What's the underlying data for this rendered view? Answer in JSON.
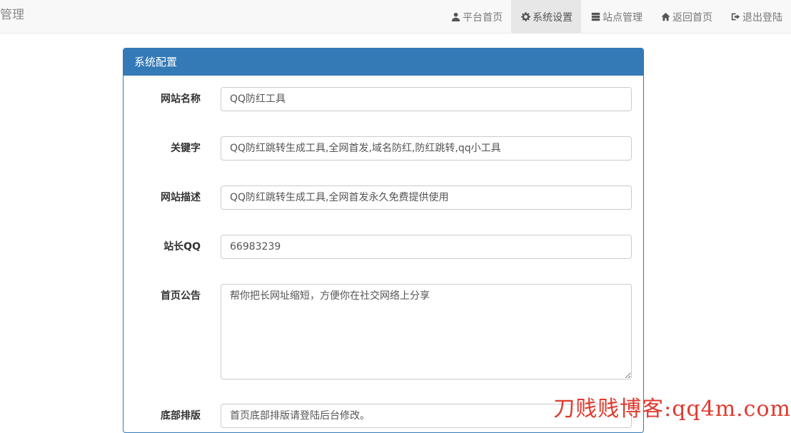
{
  "navbar": {
    "brand": "管理",
    "items": [
      {
        "label": "平台首页",
        "icon": "user-icon",
        "active": false
      },
      {
        "label": "系统设置",
        "icon": "gear-icon",
        "active": true
      },
      {
        "label": "站点管理",
        "icon": "server-icon",
        "active": false
      },
      {
        "label": "返回首页",
        "icon": "home-icon",
        "active": false
      },
      {
        "label": "退出登陆",
        "icon": "logout-icon",
        "active": false
      }
    ]
  },
  "panel": {
    "title": "系统配置",
    "fields": [
      {
        "label": "网站名称",
        "value": "QQ防红工具"
      },
      {
        "label": "关键字",
        "value": "QQ防红跳转生成工具,全网首发,域名防红,防红跳转,qq小工具"
      },
      {
        "label": "网站描述",
        "value": "QQ防红跳转生成工具,全网首发永久免费提供使用"
      },
      {
        "label": "站长QQ",
        "value": "66983239"
      },
      {
        "label": "首页公告",
        "value": "帮你把长网址缩短，方便你在社交网络上分享"
      },
      {
        "label": "底部排版",
        "value": "首页底部排版请登陆后台修改。"
      }
    ]
  },
  "watermark": "刀贱贱博客:qq4m.com",
  "colors": {
    "primary": "#337ab7",
    "watermark": "#e03a2e"
  }
}
